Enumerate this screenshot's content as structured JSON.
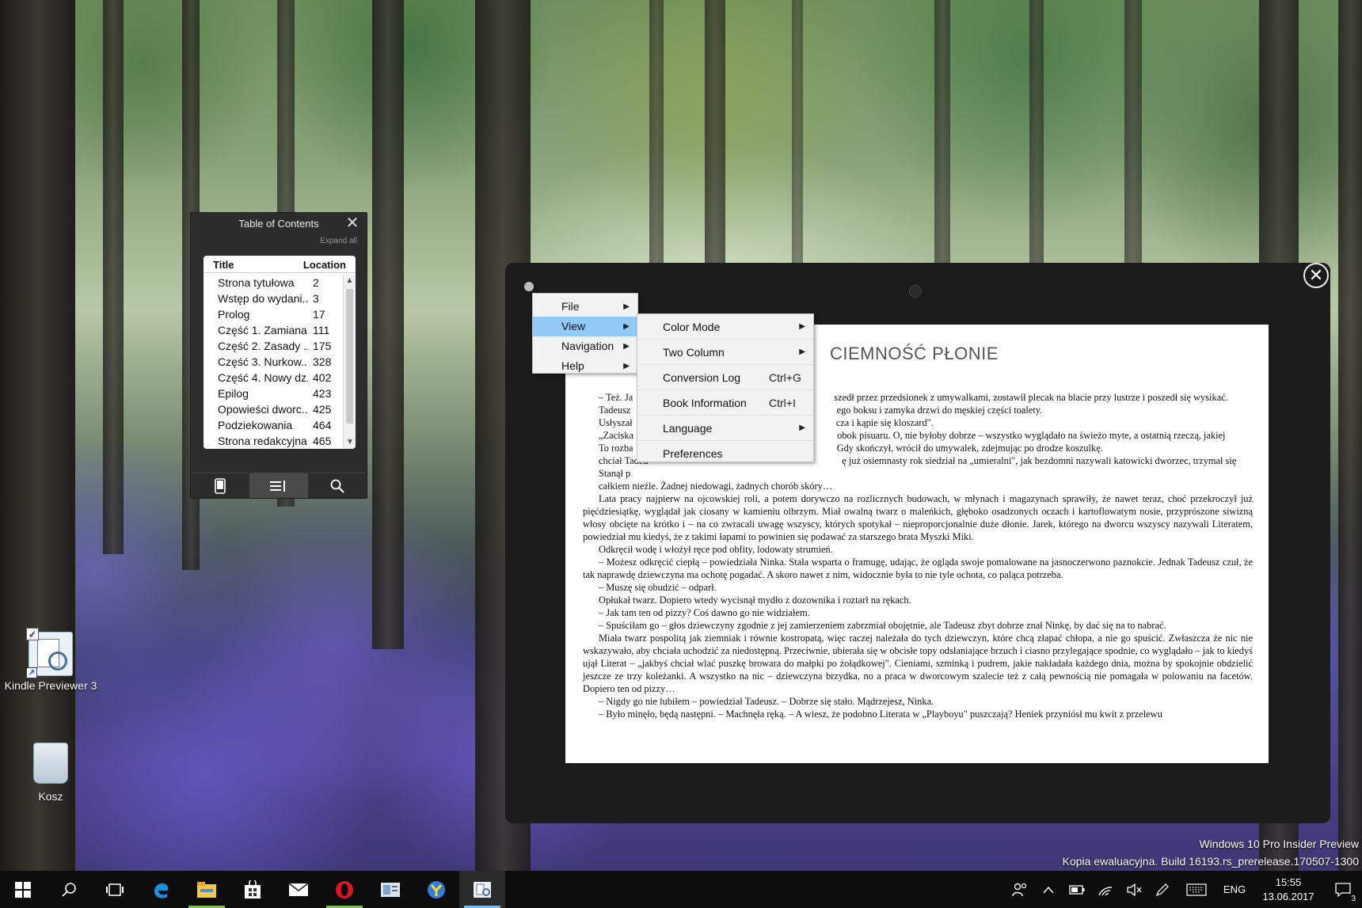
{
  "desktop": {
    "icons": [
      {
        "label": "Kindle Previewer 3"
      },
      {
        "label": "Kosz"
      }
    ],
    "watermark": {
      "line1": "Windows 10 Pro Insider Preview",
      "line2": "Kopia ewaluacyjna. Build 16193.rs_prerelease.170507-1300"
    }
  },
  "toc": {
    "title": "Table of Contents",
    "close_glyph": "✕",
    "expand_all": "Expand all",
    "col_title": "Title",
    "col_location": "Location",
    "rows": [
      {
        "title": "Strona tytułowa",
        "location": "2"
      },
      {
        "title": "Wstęp do wydani...",
        "location": "3"
      },
      {
        "title": "Prolog",
        "location": "17"
      },
      {
        "title": "Część 1. Zamiana",
        "location": "111"
      },
      {
        "title": "Część 2. Zasady ...",
        "location": "175"
      },
      {
        "title": "Część 3. Nurkow...",
        "location": "328"
      },
      {
        "title": "Część 4. Nowy dz...",
        "location": "402"
      },
      {
        "title": "Epilog",
        "location": "423"
      },
      {
        "title": "Opowieści dworc...",
        "location": "425"
      },
      {
        "title": "Podziekowania",
        "location": "464"
      },
      {
        "title": "Strona redakcyjna",
        "location": "465"
      }
    ],
    "tabs": [
      {
        "icon": "device-icon"
      },
      {
        "icon": "toc-list-icon",
        "active": true
      },
      {
        "icon": "search-icon"
      }
    ]
  },
  "menu": {
    "items": [
      {
        "label": "File"
      },
      {
        "label": "View",
        "selected": true
      },
      {
        "label": "Navigation"
      },
      {
        "label": "Help"
      }
    ],
    "view_submenu": [
      {
        "label": "Color Mode",
        "shortcut": "",
        "submenu": true
      },
      {
        "label": "Two Column",
        "shortcut": "",
        "submenu": true
      },
      {
        "label": "Conversion Log",
        "shortcut": "Ctrl+G"
      },
      {
        "label": "Book Information",
        "shortcut": "Ctrl+I"
      },
      {
        "label": "Language",
        "shortcut": "",
        "submenu": true
      },
      {
        "label": "Preferences",
        "shortcut": ""
      }
    ],
    "arrow_glyph": "▶"
  },
  "previewer": {
    "close_glyph": "✕",
    "book_title": "CIEMNOŚĆ PŁONIE",
    "paragraphs": [
      "– Też. Ja                                                                                  szedł przez przedsionek z umywalkami, zostawił plecak na blacie przy lustrze i poszedł się wysikać.",
      "Tadeusz                                                                                    ego boksu i zamyka drzwi do męskiej części toalety.",
      "Usłyszał                                                                                   cza i kąpie się kloszard\".",
      "„Zaciska                                                                                   obok pisuaru. O, nie byłoby dobrze – wszystko wyglądało na świeżo myte, a ostatnią rzeczą, jakiej",
      "To rozba                                                                                   Gdy skończył, wrócił do umywalek, zdejmując po drodze koszulkę.",
      "chciał Tadeu                                                                               ę już osiemnasty rok siedział na „umieralni\", jak bezdomni nazywali katowicki dworzec, trzymał się",
      "Stanął p                                                                                   ",
      "całkiem nieźle. Żadnej niedowagi, żadnych chorób skóry…",
      "Lata pracy najpierw na ojcowskiej roli, a potem dorywczo na rozlicznych budowach, w młynach i magazynach sprawiły, że nawet teraz, choć przekroczył już pięćdziesiątkę, wyglądał jak ciosany w kamieniu olbrzym. Miał owalną twarz o maleńkich, głęboko osadzonych oczach i kartoflowatym nosie, przyprószone siwizną włosy obcięte na krótko i – na co zwracali uwagę wszyscy, których spotykał – nieproporcjonalnie duże dłonie. Jarek, którego na dworcu wszyscy nazywali Literatem, powiedział mu kiedyś, że z takimi łapami to powinien się podawać za starszego brata Myszki Miki.",
      "Odkręcił wodę i włożył ręce pod obfity, lodowaty strumień.",
      "– Możesz odkręcić ciepłą – powiedziała Ninka. Stała wsparta o framugę, udając, że ogląda swoje pomalowane na jasnoczerwono paznokcie. Jednak Tadeusz czuł, że tak naprawdę dziewczyna ma ochotę pogadać. A skoro nawet z nim, widocznie była to nie tyle ochota, co paląca potrzeba.",
      "– Muszę się obudzić – odparł.",
      "Opłukał twarz. Dopiero wtedy wycisnął mydło z dozownika i roztarł na rękach.",
      "– Jak tam ten od pizzy? Coś dawno go nie widziałem.",
      "– Spuściłam go – głos dziewczyny zgodnie z jej zamierzeniem zabrzmiał obojętnie, ale Tadeusz zbyt dobrze znał Ninkę, by dać się na to nabrać.",
      "Miała twarz pospolitą jak ziemniak i równie kostropatą, więc raczej należała do tych dziewczyn, które chcą złapać chłopa, a nie go spuścić. Zwłaszcza że nic nie wskazywało, aby chciała uchodzić za niedostępną. Przeciwnie, ubierała się w obcisłe topy odsłaniające brzuch i ciasno przylegające spodnie, co wyglądało – jak to kiedyś ujął Literat – „jakbyś chciał wlać puszkę browara do małpki po żołądkowej\". Cieniami, szminką i pudrem, jakie nakładała każdego dnia, można by spokojnie obdzielić jeszcze ze trzy koleżanki. A wszystko na nic – dziewczyna brzydka, no a praca w dworcowym szalecie też z całą pewnością nie pomagała w polowaniu na facetów. Dopiero ten od pizzy…",
      "– Nigdy go nie lubiłem – powiedział Tadeusz. – Dobrze się stało. Mądrzejesz, Ninka.",
      "– Było minęło, będą następni. – Machnęła ręką. – A wiesz, że podobno Literata w „Playboyu\" puszczają? Heniek przyniósł mu kwit z przelewu"
    ]
  },
  "taskbar": {
    "apps": [
      {
        "icon": "windows-start-icon"
      },
      {
        "icon": "search-icon"
      },
      {
        "icon": "task-view-icon"
      },
      {
        "icon": "edge-icon"
      },
      {
        "icon": "file-explorer-icon",
        "running": true
      },
      {
        "icon": "store-icon"
      },
      {
        "icon": "mail-icon"
      },
      {
        "icon": "opera-icon",
        "running": true
      },
      {
        "icon": "ebook-app-icon"
      },
      {
        "icon": "yandex-icon"
      },
      {
        "icon": "kindle-previewer-icon",
        "running": true,
        "active": true
      }
    ],
    "tray": {
      "language": "ENG",
      "time": "15:55",
      "date": "13.06.2017",
      "notification_count": "3"
    }
  },
  "colors": {
    "menu_selected": "#91c9f7",
    "taskbar": "#0d0d0d",
    "running_indicator": "#76b9ed"
  }
}
